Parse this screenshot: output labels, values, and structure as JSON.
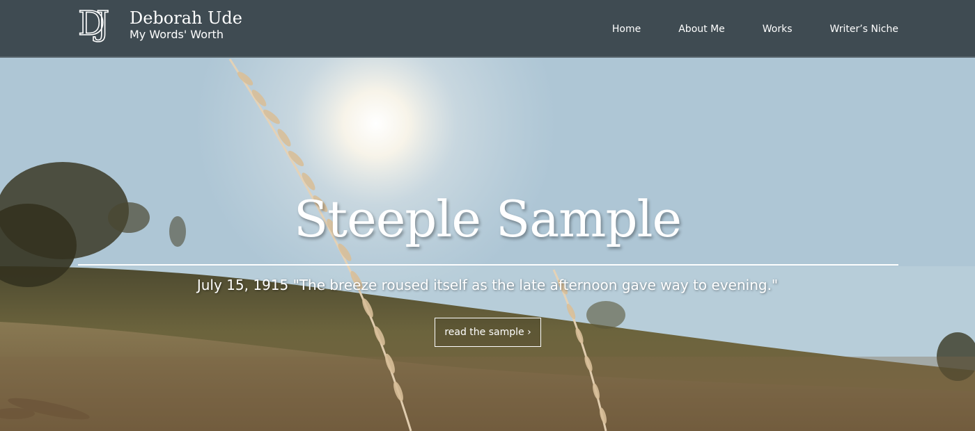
{
  "brand": {
    "monogram": "DJ",
    "name": "Deborah Ude",
    "tagline": "My Words' Worth"
  },
  "nav": {
    "items": [
      {
        "label": "Home"
      },
      {
        "label": "About Me"
      },
      {
        "label": "Works"
      },
      {
        "label": "Writer’s Niche"
      }
    ]
  },
  "hero": {
    "title": "Steeple Sample",
    "quote": "July 15, 1915 \"The breeze roused itself as the late afternoon gave way to evening.\"",
    "button_label": "read the sample ›",
    "background_image": "sunlit-wheat-field-photo"
  },
  "colors": {
    "navbar_bg": "#3f4b52",
    "text": "#ffffff",
    "sky": "#b9cfdb",
    "grass": "#6e6a43"
  }
}
